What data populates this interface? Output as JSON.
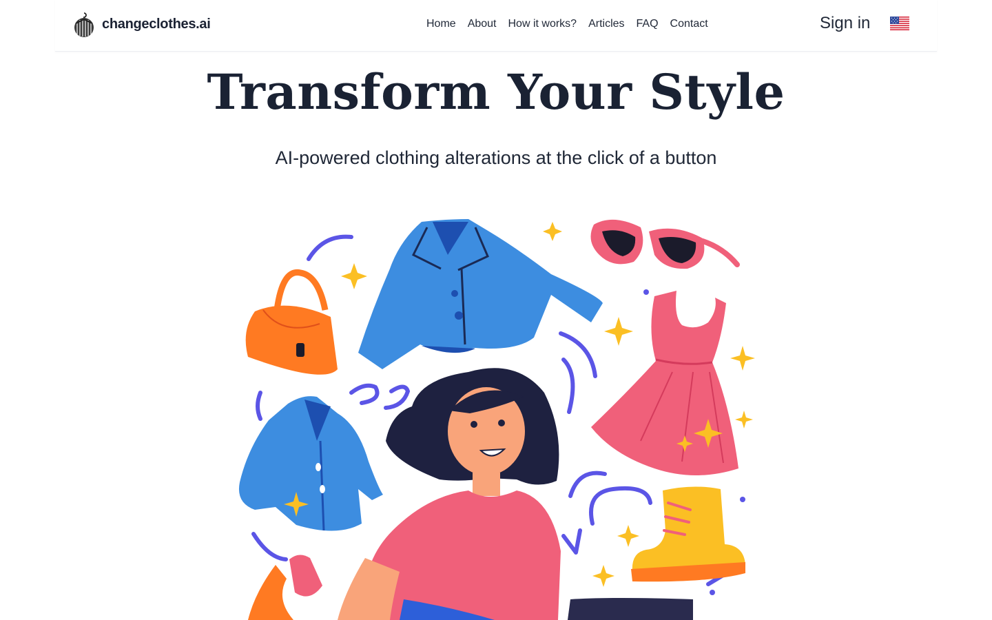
{
  "header": {
    "brand": "changeclothes.ai",
    "nav": [
      {
        "label": "Home"
      },
      {
        "label": "About"
      },
      {
        "label": "How it works?"
      },
      {
        "label": "Articles"
      },
      {
        "label": "FAQ"
      },
      {
        "label": "Contact"
      }
    ],
    "signin": "Sign in",
    "language_icon": "us-flag-icon"
  },
  "hero": {
    "title": "Transform Your Style",
    "subtitle": "AI-powered clothing alterations at the click of a button",
    "illustration": "fashion-illustration"
  },
  "colors": {
    "text": "#1b2233",
    "jacket_blue": "#3d8de0",
    "dress_pink": "#f0607a",
    "bag_orange": "#ff7a22",
    "sparkle_yellow": "#fbbf24",
    "accent_purple": "#5b55e6"
  }
}
